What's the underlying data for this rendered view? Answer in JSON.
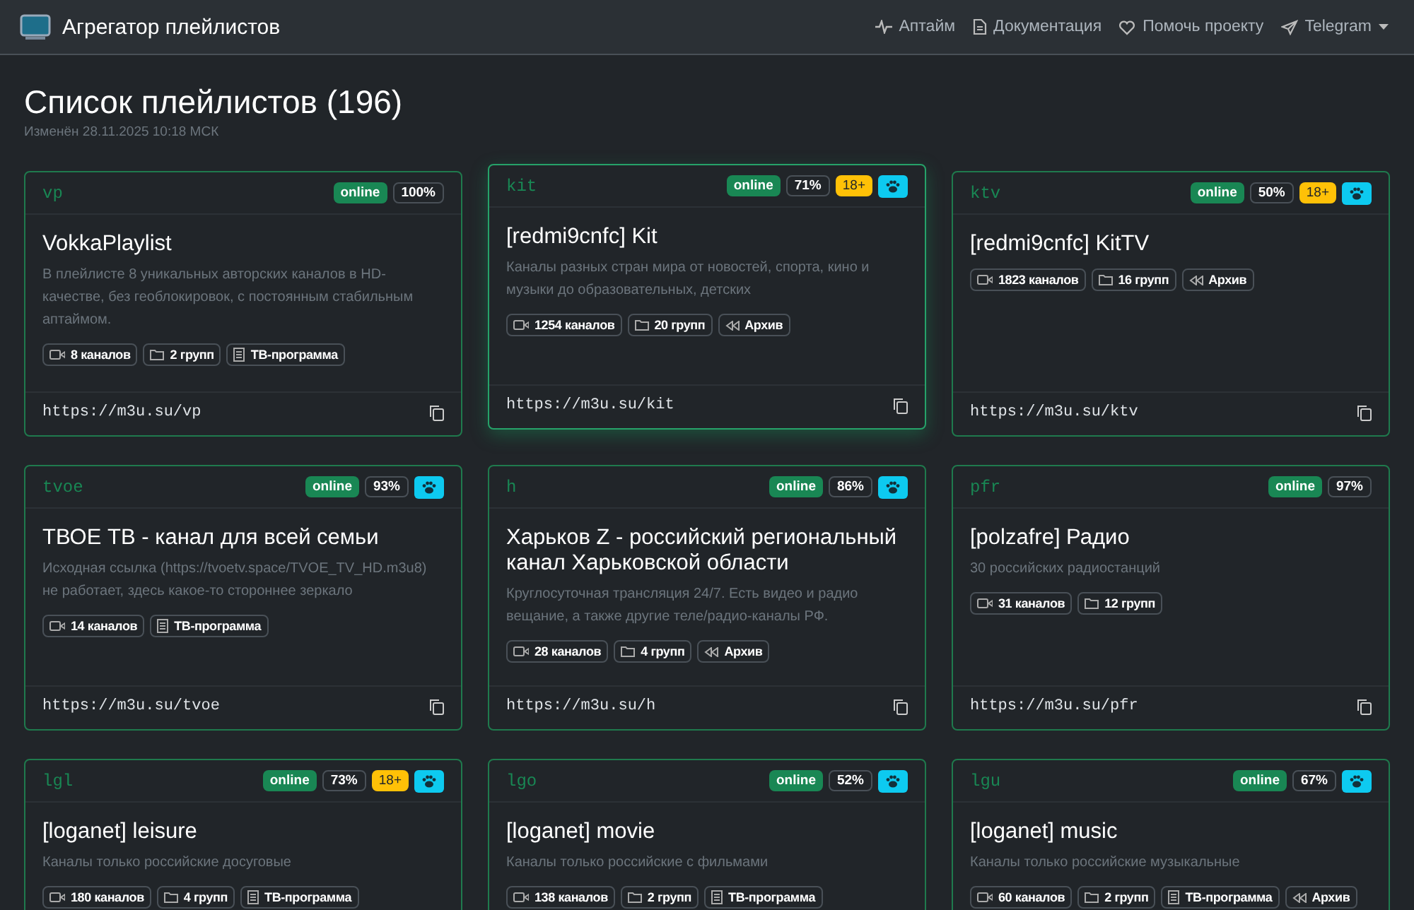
{
  "navbar": {
    "brand": "Агрегатор плейлистов",
    "links": [
      {
        "kind": "uptime",
        "label": "Аптайм"
      },
      {
        "kind": "docs",
        "label": "Документация"
      },
      {
        "kind": "donate",
        "label": "Помочь проекту"
      },
      {
        "kind": "telegram",
        "label": "Telegram",
        "dropdown": true
      }
    ]
  },
  "page": {
    "title": "Список плейлистов (196)",
    "modified": "Изменён 28.11.2025 10:18 МСК"
  },
  "cards": [
    {
      "code": "vp",
      "status": "online",
      "uptime": "100%",
      "paw": false,
      "hovered": false,
      "title": "VokkaPlaylist",
      "description": "В плейлисте 8 уникальных авторских каналов в HD-качестве, без геоблокировок, с постоянным стабильным аптаймом.",
      "tags": [
        {
          "kind": "channels",
          "label": "8 каналов"
        },
        {
          "kind": "groups",
          "label": "2 групп"
        },
        {
          "kind": "epg",
          "label": "ТВ-программа"
        }
      ],
      "url": "https://m3u.su/vp"
    },
    {
      "code": "kit",
      "status": "online",
      "uptime": "71%",
      "age": "18+",
      "paw": true,
      "hovered": true,
      "title": "[redmi9cnfc] Kit",
      "description": "Каналы разных стран мира от новостей, спорта, кино и музыки до образовательных, детских",
      "tags": [
        {
          "kind": "channels",
          "label": "1254 каналов"
        },
        {
          "kind": "groups",
          "label": "20 групп"
        },
        {
          "kind": "archive",
          "label": "Архив"
        }
      ],
      "url": "https://m3u.su/kit"
    },
    {
      "code": "ktv",
      "status": "online",
      "uptime": "50%",
      "age": "18+",
      "paw": true,
      "hovered": false,
      "title": "[redmi9cnfc] KitTV",
      "tags": [
        {
          "kind": "channels",
          "label": "1823 каналов"
        },
        {
          "kind": "groups",
          "label": "16 групп"
        },
        {
          "kind": "archive",
          "label": "Архив"
        }
      ],
      "url": "https://m3u.su/ktv"
    },
    {
      "code": "tvoe",
      "status": "online",
      "uptime": "93%",
      "paw": true,
      "hovered": false,
      "title": "ТВОЕ ТВ - канал для всей семьи",
      "description": "Исходная ссылка (https://tvoetv.space/TVOE_TV_HD.m3u8) не работает, здесь какое-то стороннее зеркало",
      "tags": [
        {
          "kind": "channels",
          "label": "14 каналов"
        },
        {
          "kind": "epg",
          "label": "ТВ-программа"
        }
      ],
      "url": "https://m3u.su/tvoe"
    },
    {
      "code": "h",
      "status": "online",
      "uptime": "86%",
      "paw": true,
      "hovered": false,
      "title": "Харьков Z - российский региональный канал Харьковской области",
      "description": "Круглосуточная трансляция 24/7. Есть видео и радио вещание, а также другие теле/радио-каналы РФ.",
      "tags": [
        {
          "kind": "channels",
          "label": "28 каналов"
        },
        {
          "kind": "groups",
          "label": "4 групп"
        },
        {
          "kind": "archive",
          "label": "Архив"
        }
      ],
      "url": "https://m3u.su/h"
    },
    {
      "code": "pfr",
      "status": "online",
      "uptime": "97%",
      "paw": false,
      "hovered": false,
      "title": "[polzafre] Радио",
      "description": "30 российских радиостанций",
      "tags": [
        {
          "kind": "channels",
          "label": "31 каналов"
        },
        {
          "kind": "groups",
          "label": "12 групп"
        }
      ],
      "url": "https://m3u.su/pfr"
    },
    {
      "code": "lgl",
      "status": "online",
      "uptime": "73%",
      "age": "18+",
      "paw": true,
      "hovered": false,
      "title": "[loganet] leisure",
      "description": "Каналы только российские досуговые",
      "tags": [
        {
          "kind": "channels",
          "label": "180 каналов"
        },
        {
          "kind": "groups",
          "label": "4 групп"
        },
        {
          "kind": "epg",
          "label": "ТВ-программа"
        }
      ]
    },
    {
      "code": "lgo",
      "status": "online",
      "uptime": "52%",
      "paw": true,
      "hovered": false,
      "title": "[loganet] movie",
      "description": "Каналы только российские с фильмами",
      "tags": [
        {
          "kind": "channels",
          "label": "138 каналов"
        },
        {
          "kind": "groups",
          "label": "2 групп"
        },
        {
          "kind": "epg",
          "label": "ТВ-программа"
        }
      ]
    },
    {
      "code": "lgu",
      "status": "online",
      "uptime": "67%",
      "paw": true,
      "hovered": false,
      "title": "[loganet] music",
      "description": "Каналы только российские музыкальные",
      "tags": [
        {
          "kind": "channels",
          "label": "60 каналов"
        },
        {
          "kind": "groups",
          "label": "2 групп"
        },
        {
          "kind": "epg",
          "label": "ТВ-программа"
        },
        {
          "kind": "archive",
          "label": "Архив"
        }
      ]
    }
  ]
}
